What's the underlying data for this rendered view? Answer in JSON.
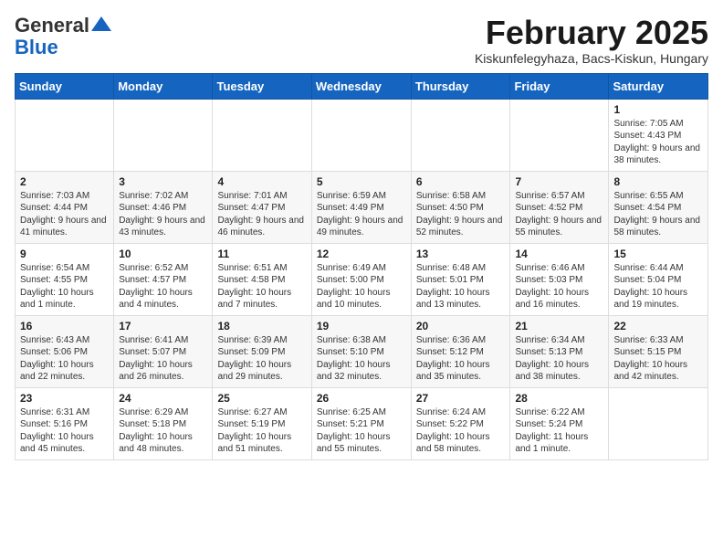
{
  "logo": {
    "general": "General",
    "blue": "Blue"
  },
  "title": {
    "month_year": "February 2025",
    "location": "Kiskunfelegyhaza, Bacs-Kiskun, Hungary"
  },
  "weekdays": [
    "Sunday",
    "Monday",
    "Tuesday",
    "Wednesday",
    "Thursday",
    "Friday",
    "Saturday"
  ],
  "weeks": [
    [
      {
        "day": "",
        "info": ""
      },
      {
        "day": "",
        "info": ""
      },
      {
        "day": "",
        "info": ""
      },
      {
        "day": "",
        "info": ""
      },
      {
        "day": "",
        "info": ""
      },
      {
        "day": "",
        "info": ""
      },
      {
        "day": "1",
        "info": "Sunrise: 7:05 AM\nSunset: 4:43 PM\nDaylight: 9 hours and 38 minutes."
      }
    ],
    [
      {
        "day": "2",
        "info": "Sunrise: 7:03 AM\nSunset: 4:44 PM\nDaylight: 9 hours and 41 minutes."
      },
      {
        "day": "3",
        "info": "Sunrise: 7:02 AM\nSunset: 4:46 PM\nDaylight: 9 hours and 43 minutes."
      },
      {
        "day": "4",
        "info": "Sunrise: 7:01 AM\nSunset: 4:47 PM\nDaylight: 9 hours and 46 minutes."
      },
      {
        "day": "5",
        "info": "Sunrise: 6:59 AM\nSunset: 4:49 PM\nDaylight: 9 hours and 49 minutes."
      },
      {
        "day": "6",
        "info": "Sunrise: 6:58 AM\nSunset: 4:50 PM\nDaylight: 9 hours and 52 minutes."
      },
      {
        "day": "7",
        "info": "Sunrise: 6:57 AM\nSunset: 4:52 PM\nDaylight: 9 hours and 55 minutes."
      },
      {
        "day": "8",
        "info": "Sunrise: 6:55 AM\nSunset: 4:54 PM\nDaylight: 9 hours and 58 minutes."
      }
    ],
    [
      {
        "day": "9",
        "info": "Sunrise: 6:54 AM\nSunset: 4:55 PM\nDaylight: 10 hours and 1 minute."
      },
      {
        "day": "10",
        "info": "Sunrise: 6:52 AM\nSunset: 4:57 PM\nDaylight: 10 hours and 4 minutes."
      },
      {
        "day": "11",
        "info": "Sunrise: 6:51 AM\nSunset: 4:58 PM\nDaylight: 10 hours and 7 minutes."
      },
      {
        "day": "12",
        "info": "Sunrise: 6:49 AM\nSunset: 5:00 PM\nDaylight: 10 hours and 10 minutes."
      },
      {
        "day": "13",
        "info": "Sunrise: 6:48 AM\nSunset: 5:01 PM\nDaylight: 10 hours and 13 minutes."
      },
      {
        "day": "14",
        "info": "Sunrise: 6:46 AM\nSunset: 5:03 PM\nDaylight: 10 hours and 16 minutes."
      },
      {
        "day": "15",
        "info": "Sunrise: 6:44 AM\nSunset: 5:04 PM\nDaylight: 10 hours and 19 minutes."
      }
    ],
    [
      {
        "day": "16",
        "info": "Sunrise: 6:43 AM\nSunset: 5:06 PM\nDaylight: 10 hours and 22 minutes."
      },
      {
        "day": "17",
        "info": "Sunrise: 6:41 AM\nSunset: 5:07 PM\nDaylight: 10 hours and 26 minutes."
      },
      {
        "day": "18",
        "info": "Sunrise: 6:39 AM\nSunset: 5:09 PM\nDaylight: 10 hours and 29 minutes."
      },
      {
        "day": "19",
        "info": "Sunrise: 6:38 AM\nSunset: 5:10 PM\nDaylight: 10 hours and 32 minutes."
      },
      {
        "day": "20",
        "info": "Sunrise: 6:36 AM\nSunset: 5:12 PM\nDaylight: 10 hours and 35 minutes."
      },
      {
        "day": "21",
        "info": "Sunrise: 6:34 AM\nSunset: 5:13 PM\nDaylight: 10 hours and 38 minutes."
      },
      {
        "day": "22",
        "info": "Sunrise: 6:33 AM\nSunset: 5:15 PM\nDaylight: 10 hours and 42 minutes."
      }
    ],
    [
      {
        "day": "23",
        "info": "Sunrise: 6:31 AM\nSunset: 5:16 PM\nDaylight: 10 hours and 45 minutes."
      },
      {
        "day": "24",
        "info": "Sunrise: 6:29 AM\nSunset: 5:18 PM\nDaylight: 10 hours and 48 minutes."
      },
      {
        "day": "25",
        "info": "Sunrise: 6:27 AM\nSunset: 5:19 PM\nDaylight: 10 hours and 51 minutes."
      },
      {
        "day": "26",
        "info": "Sunrise: 6:25 AM\nSunset: 5:21 PM\nDaylight: 10 hours and 55 minutes."
      },
      {
        "day": "27",
        "info": "Sunrise: 6:24 AM\nSunset: 5:22 PM\nDaylight: 10 hours and 58 minutes."
      },
      {
        "day": "28",
        "info": "Sunrise: 6:22 AM\nSunset: 5:24 PM\nDaylight: 11 hours and 1 minute."
      },
      {
        "day": "",
        "info": ""
      }
    ]
  ]
}
